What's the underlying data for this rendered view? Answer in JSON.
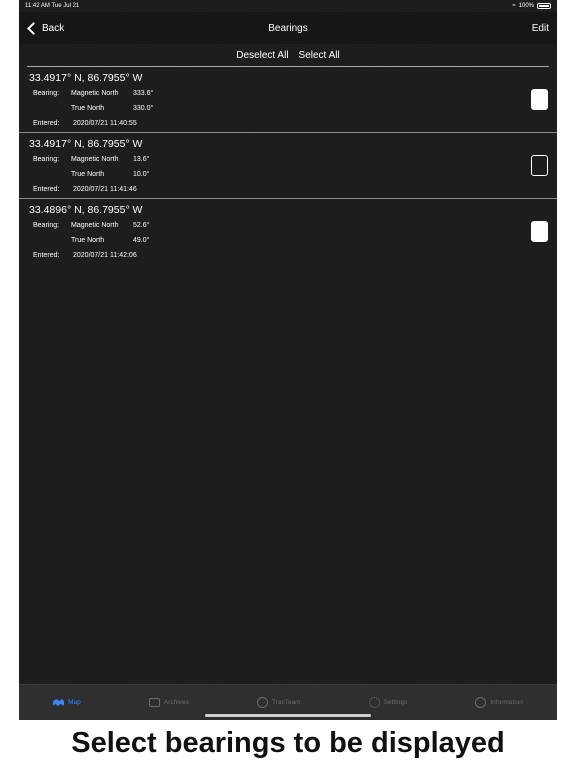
{
  "status": {
    "time": "11:42 AM  Tue Jul 21",
    "battery": "100%"
  },
  "nav": {
    "back_label": "Back",
    "title": "Bearings",
    "edit_label": "Edit"
  },
  "selection": {
    "deselect_all": "Deselect All",
    "select_all": "Select All"
  },
  "labels": {
    "bearing": "Bearing:",
    "entered": "Entered:",
    "magnetic_north": "Magnetic North",
    "true_north": "True North"
  },
  "bearings": [
    {
      "coord": "33.4917° N, 86.7955° W",
      "magnetic": "333.6°",
      "true": "330.0°",
      "entered": "2020/07/21 11:40:55",
      "selected": true
    },
    {
      "coord": "33.4917° N, 86.7955° W",
      "magnetic": "13.6°",
      "true": "10.0°",
      "entered": "2020/07/21 11:41:46",
      "selected": false
    },
    {
      "coord": "33.4896° N, 86.7955° W",
      "magnetic": "52.6°",
      "true": "49.0°",
      "entered": "2020/07/21 11:42:06",
      "selected": true
    }
  ],
  "tabs": [
    {
      "label": "Map",
      "icon": "map-icon",
      "active": true
    },
    {
      "label": "Archives",
      "icon": "archives-icon",
      "active": false
    },
    {
      "label": "TraxTeam",
      "icon": "team-icon",
      "active": false
    },
    {
      "label": "Settings",
      "icon": "gear-icon",
      "active": false
    },
    {
      "label": "Information",
      "icon": "info-icon",
      "active": false
    }
  ],
  "caption": "Select bearings to be displayed",
  "colors": {
    "background": "#1c1c1c",
    "active_tab": "#3a86ff",
    "inactive_tab": "#6b6b6b"
  }
}
